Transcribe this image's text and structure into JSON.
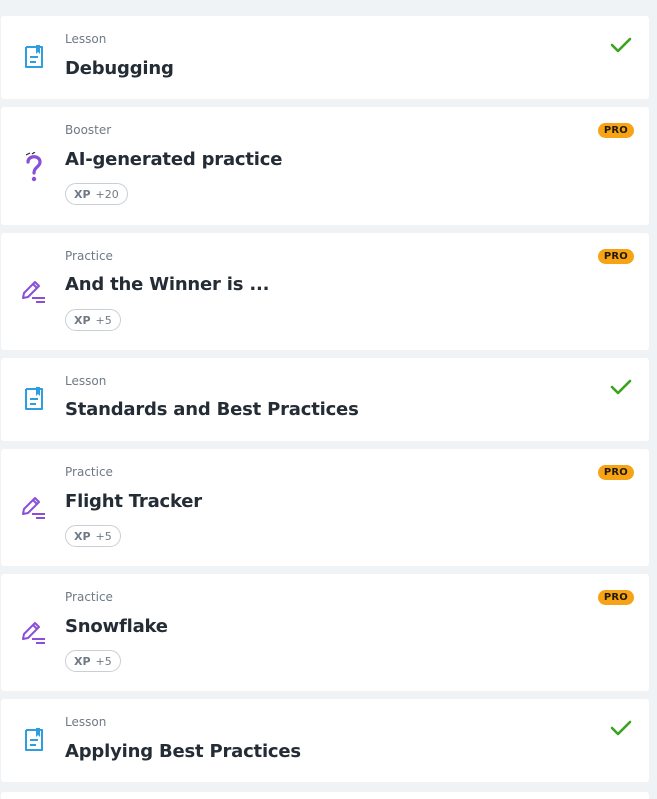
{
  "colors": {
    "background": "#f0f3f6",
    "lesson_icon": "#2d9fe0",
    "booster_icon": "#8a4fd8",
    "practice_icon": "#8a4fd8",
    "check": "#3aa31f",
    "pro_badge": "#f6a316"
  },
  "items": [
    {
      "kind": "Lesson",
      "title": "Debugging",
      "icon": "document-icon",
      "status": "completed"
    },
    {
      "kind": "Booster",
      "title": "AI-generated practice",
      "icon": "question-icon",
      "badge": "PRO",
      "xp_label": "XP",
      "xp_value": "+20"
    },
    {
      "kind": "Practice",
      "title": "And the Winner is ...",
      "icon": "edit-icon",
      "badge": "PRO",
      "xp_label": "XP",
      "xp_value": "+5"
    },
    {
      "kind": "Lesson",
      "title": "Standards and Best Practices",
      "icon": "document-icon",
      "status": "completed"
    },
    {
      "kind": "Practice",
      "title": "Flight Tracker",
      "icon": "edit-icon",
      "badge": "PRO",
      "xp_label": "XP",
      "xp_value": "+5"
    },
    {
      "kind": "Practice",
      "title": "Snowflake",
      "icon": "edit-icon",
      "badge": "PRO",
      "xp_label": "XP",
      "xp_value": "+5"
    },
    {
      "kind": "Lesson",
      "title": "Applying Best Practices",
      "icon": "document-icon",
      "status": "completed"
    }
  ]
}
